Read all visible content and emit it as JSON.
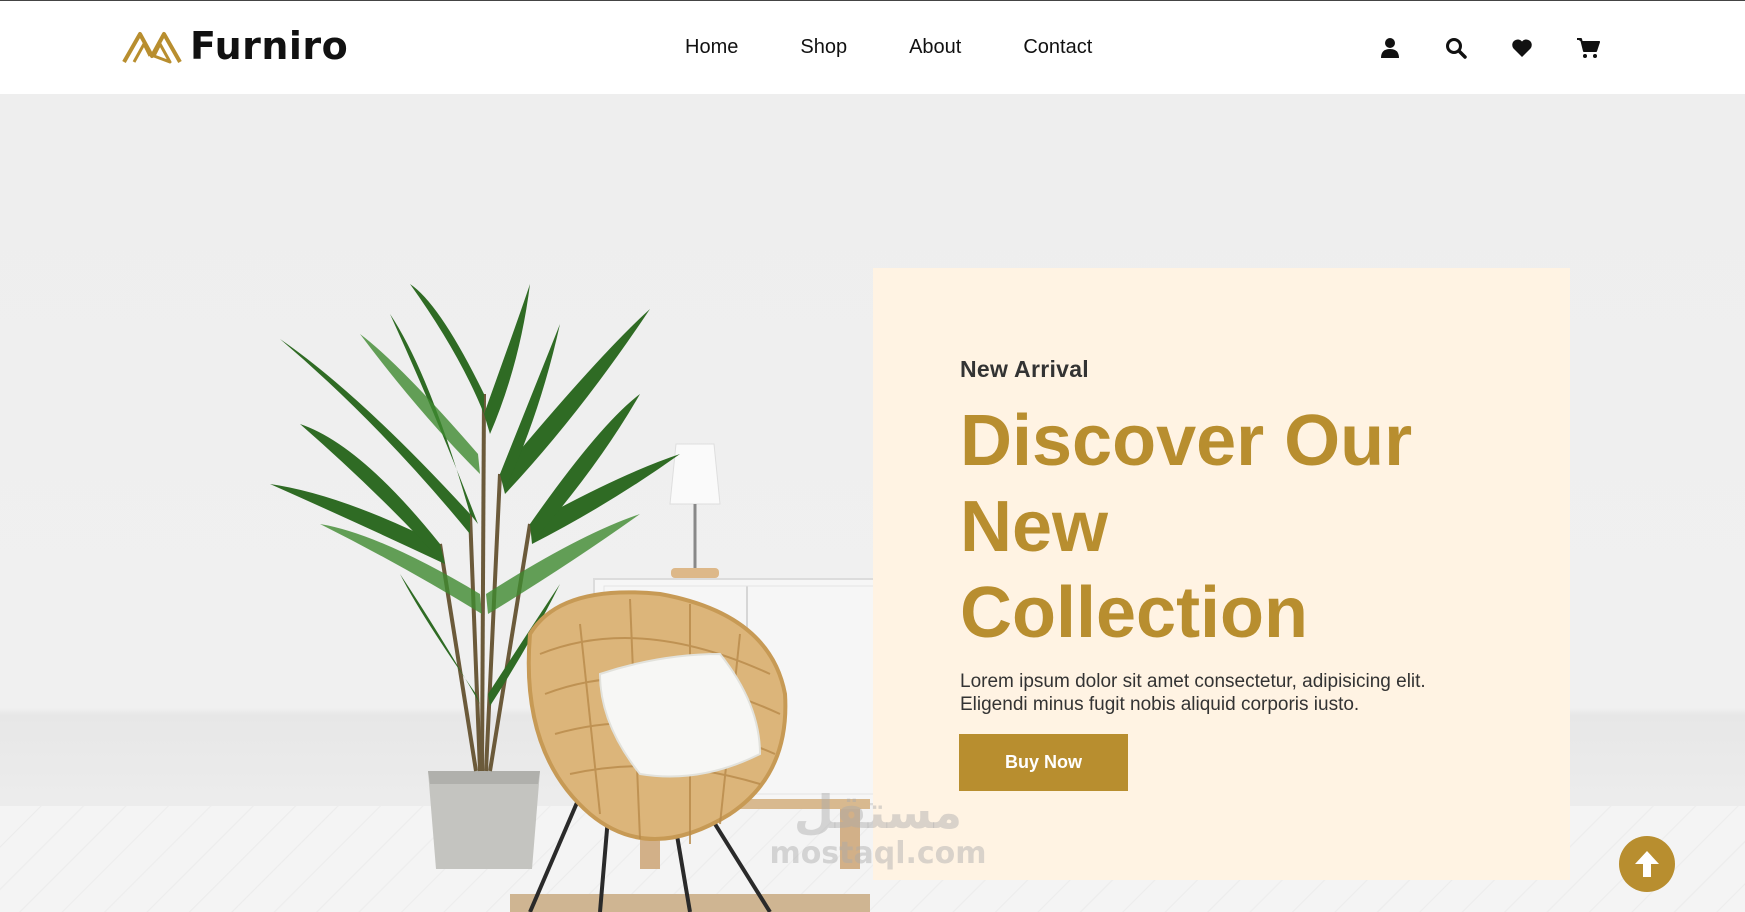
{
  "brand": {
    "name": "Furniro",
    "logo_icon": "furniro-logo-icon",
    "accent_color": "#b88e2f"
  },
  "nav": {
    "items": [
      {
        "label": "Home"
      },
      {
        "label": "Shop"
      },
      {
        "label": "About"
      },
      {
        "label": "Contact"
      }
    ]
  },
  "header_icons": [
    "user-icon",
    "search-icon",
    "heart-icon",
    "cart-icon"
  ],
  "hero": {
    "eyebrow": "New Arrival",
    "headline_lines": [
      "Discover Our",
      "New",
      "Collection"
    ],
    "description_lines": [
      "Lorem ipsum dolor sit amet consectetur, adipisicing elit.",
      "Eligendi minus fugit nobis aliquid corporis iusto."
    ],
    "button_label": "Buy Now",
    "card_color": "#fff3e3"
  },
  "watermark": {
    "arabic": "مستقل",
    "latin": "mostaql.com"
  },
  "scroll_top_icon": "arrow-up-icon"
}
